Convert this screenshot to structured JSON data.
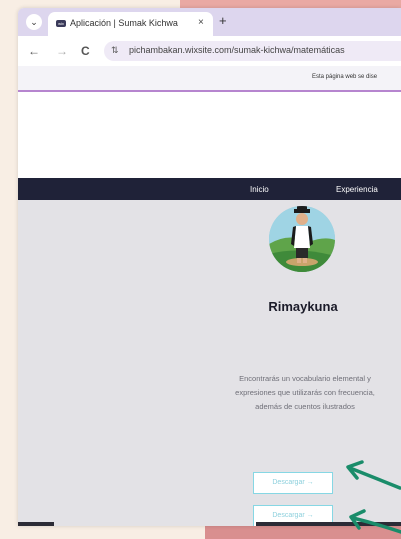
{
  "browser": {
    "tab_title": "Aplicación | Sumak Kichwa",
    "tab_close": "×",
    "new_tab": "+",
    "favicon_text": "wix",
    "menu_glyph": "⌄",
    "back_glyph": "←",
    "forward_glyph": "→",
    "reload_glyph": "C",
    "url_icon_glyph": "⇅",
    "url": "pichambakan.wixsite.com/sumak-kichwa/matemáticas"
  },
  "notice": {
    "text": "Esta página web se dise"
  },
  "site": {
    "nav": [
      "Inicio",
      "Experiencia"
    ],
    "title": "Rimaykuna",
    "description": "Encontrarás un vocabulario elemental y expresiones que utilizarás con frecuencia, además de cuentos ilustrados",
    "buttons": [
      "Descargar →",
      "Descargar →"
    ]
  },
  "colors": {
    "nav_bg": "#1f2238",
    "arrow": "#1a8c6a",
    "button_border": "#86d7e4"
  }
}
